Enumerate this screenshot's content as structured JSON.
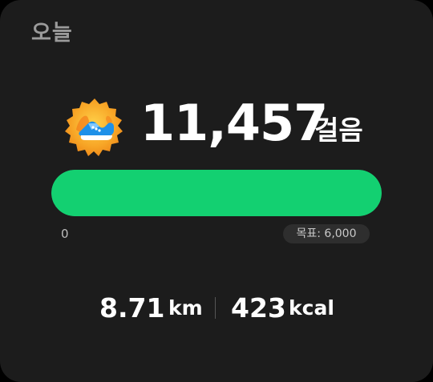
{
  "header": {
    "title": "오늘"
  },
  "steps": {
    "count": "11,457",
    "unit": "걸음"
  },
  "progress": {
    "min_label": "0",
    "goal_label": "목표: 6,000",
    "fraction": 1.0,
    "color": "#13d071"
  },
  "stats": {
    "distance_value": "8.71",
    "distance_unit": "km",
    "calories_value": "423",
    "calories_unit": "kcal"
  },
  "badge": {
    "icon": "running-shoe-badge-icon"
  }
}
